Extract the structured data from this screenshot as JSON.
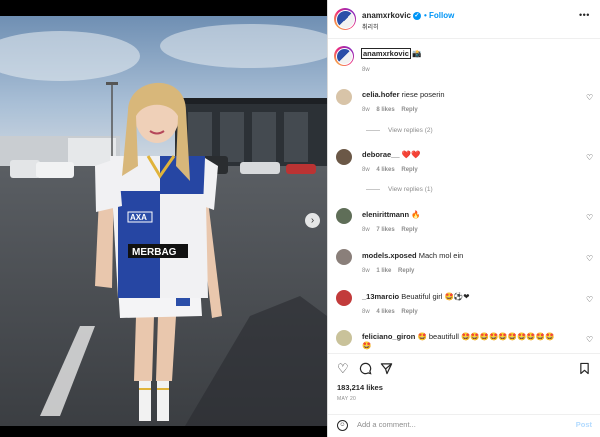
{
  "post": {
    "author": "anamxrkovic",
    "follow_label": "Follow",
    "audio_label": "취리히",
    "more_label": "•••",
    "caption_user": "anamxrkovic",
    "caption_emoji": "📸",
    "caption_time": "8w",
    "likes": "183,214 likes",
    "date": "MAY 20",
    "close_label": "✕",
    "next_label": "›"
  },
  "comments": [
    {
      "user": "celia.hofer",
      "text": "riese poserin",
      "time": "8w",
      "likes": "8 likes",
      "reply": "Reply",
      "view_replies": "View replies (2)",
      "avatar_color": "#d8c4a8"
    },
    {
      "user": "deborae__",
      "text": "❤️❤️",
      "time": "8w",
      "likes": "4 likes",
      "reply": "Reply",
      "view_replies": "View replies (1)",
      "avatar_color": "#6b5847"
    },
    {
      "user": "elenirittmann",
      "text": "🔥",
      "time": "8w",
      "likes": "7 likes",
      "reply": "Reply",
      "view_replies": "",
      "avatar_color": "#5f6e58"
    },
    {
      "user": "models.xposed",
      "text": "Mach mol ein",
      "time": "8w",
      "likes": "1 like",
      "reply": "Reply",
      "view_replies": "",
      "avatar_color": "#8a7f7a"
    },
    {
      "user": "_13marcio",
      "text": "Beuatiful girl 🤩⚽❤",
      "time": "8w",
      "likes": "4 likes",
      "reply": "Reply",
      "view_replies": "",
      "avatar_color": "#c23b3b"
    },
    {
      "user": "feliciano_giron",
      "text": "🤩 beautifull 🤩🤩🤩🤩🤩🤩🤩🤩🤩🤩",
      "text2": "🤩",
      "time": "",
      "likes": "",
      "reply": "",
      "view_replies": "",
      "avatar_color": "#c9c29a"
    }
  ],
  "actions": {
    "like_icon": "heart-icon",
    "comment_icon": "comment-icon",
    "share_icon": "share-icon",
    "save_icon": "bookmark-icon"
  },
  "composer": {
    "placeholder": "Add a comment...",
    "post_label": "Post"
  }
}
